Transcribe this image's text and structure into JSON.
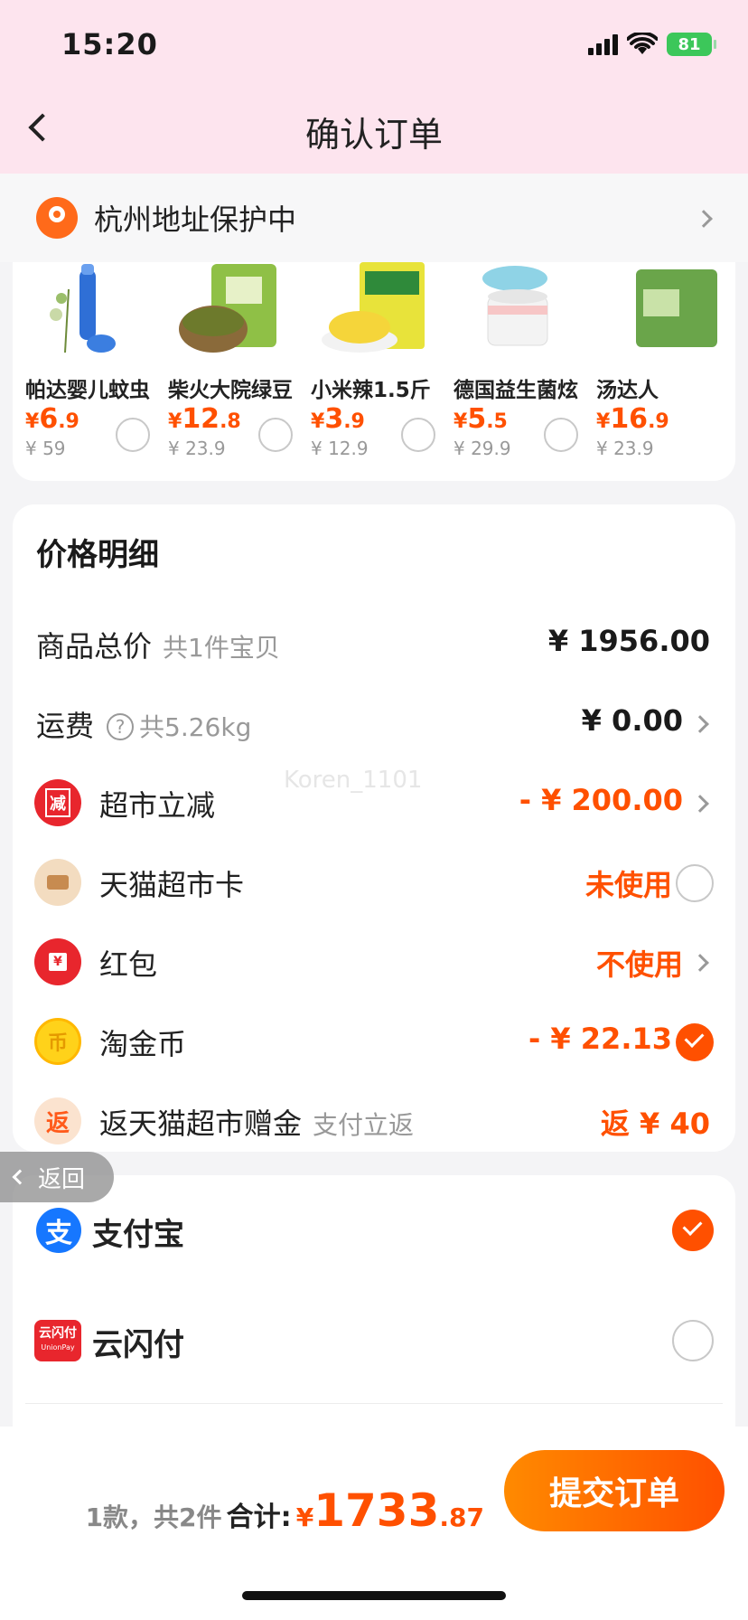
{
  "status": {
    "time": "15:20",
    "battery": "81"
  },
  "header": {
    "title": "确认订单"
  },
  "address": {
    "text": "杭州地址保护中"
  },
  "products": [
    {
      "name": "帕达婴儿蚊虫",
      "price_int": "6",
      "price_dec": ".9",
      "orig": "¥ 59",
      "icon": "mosquito-repellent-icon"
    },
    {
      "name": "柴火大院绿豆",
      "price_int": "12",
      "price_dec": ".8",
      "orig": "¥ 23.9",
      "icon": "mung-bean-icon"
    },
    {
      "name": "小米辣1.5斤",
      "price_int": "3",
      "price_dec": ".9",
      "orig": "¥ 12.9",
      "icon": "pickled-pepper-icon"
    },
    {
      "name": "德国益生菌炫",
      "price_int": "5",
      "price_dec": ".5",
      "orig": "¥ 29.9",
      "icon": "probiotic-jar-icon"
    },
    {
      "name": "汤达人",
      "price_int": "16",
      "price_dec": ".9",
      "orig": "¥ 23.9",
      "icon": "noodle-pack-icon"
    }
  ],
  "price_detail": {
    "title": "价格明细",
    "goods_total": {
      "label": "商品总价",
      "sub": "共1件宝贝",
      "value": "¥ 1956.00"
    },
    "shipping": {
      "label": "运费",
      "sub": "共5.26kg",
      "value": "¥ 0.00"
    },
    "market_discount": {
      "label": "超市立减",
      "value": "- ¥ 200.00",
      "icon_text": "减"
    },
    "tmall_card": {
      "label": "天猫超市卡",
      "value": "未使用"
    },
    "red_packet": {
      "label": "红包",
      "value": "不使用",
      "icon_text": "¥"
    },
    "taojin_coin": {
      "label": "淘金币",
      "value": "- ¥ 22.13",
      "icon_text": "币"
    },
    "cashback": {
      "label": "返天猫超市赠金",
      "sub": "支付立返",
      "value": "返 ¥ 40",
      "icon_text": "返"
    },
    "watermark": "Koren_1101"
  },
  "payment": {
    "alipay": {
      "label": "支付宝",
      "icon_text": "支"
    },
    "unionpay": {
      "label": "云闪付",
      "icon_text": "云闪付",
      "icon_sub": "UnionPay"
    }
  },
  "back_pill": {
    "label": "返回"
  },
  "bottom": {
    "count": "1款，共2件",
    "total_label": "合计:",
    "yen": "¥",
    "total_int": "1733",
    "total_dec": ".87",
    "submit_label": "提交订单"
  },
  "colors": {
    "accent": "#ff5000",
    "header_bg": "#fde4ee",
    "alipay_blue": "#1677ff",
    "unionpay_red": "#e8262d"
  }
}
